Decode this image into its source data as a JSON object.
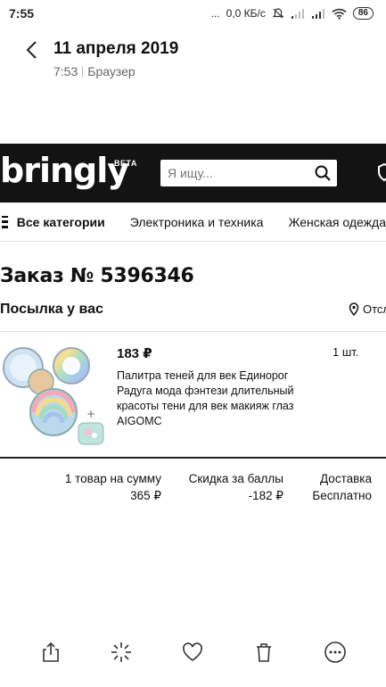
{
  "status_bar": {
    "time": "7:55",
    "dots": "...",
    "speed": "0,0 КБ/с",
    "battery": "86"
  },
  "notification": {
    "title": "11 апреля 2019",
    "time": "7:53",
    "app": "Браузер"
  },
  "header": {
    "logo": "bringly",
    "beta": "BETA",
    "search_placeholder": "Я ищу..."
  },
  "nav": {
    "all_categories": "Все категории",
    "items": [
      "Электроника и техника",
      "Женская одежда"
    ]
  },
  "order": {
    "title": "Заказ № 5396346",
    "status": "Посылка у вас",
    "track_label": "Отсл"
  },
  "product": {
    "price": "183 ₽",
    "quantity": "1 шт.",
    "name": "Палитра теней для век Единорог Радуга мода фэнтези длительный красоты тени для век макияж глаз AIGOMC"
  },
  "summary": {
    "items_label": "1 товар на сумму",
    "items_value": "365 ₽",
    "discount_label": "Скидка за баллы",
    "discount_value": "-182 ₽",
    "delivery_label": "Доставка",
    "delivery_value": "Бесплатно"
  },
  "colors": {
    "header_bg": "#131313",
    "text": "#111111"
  }
}
